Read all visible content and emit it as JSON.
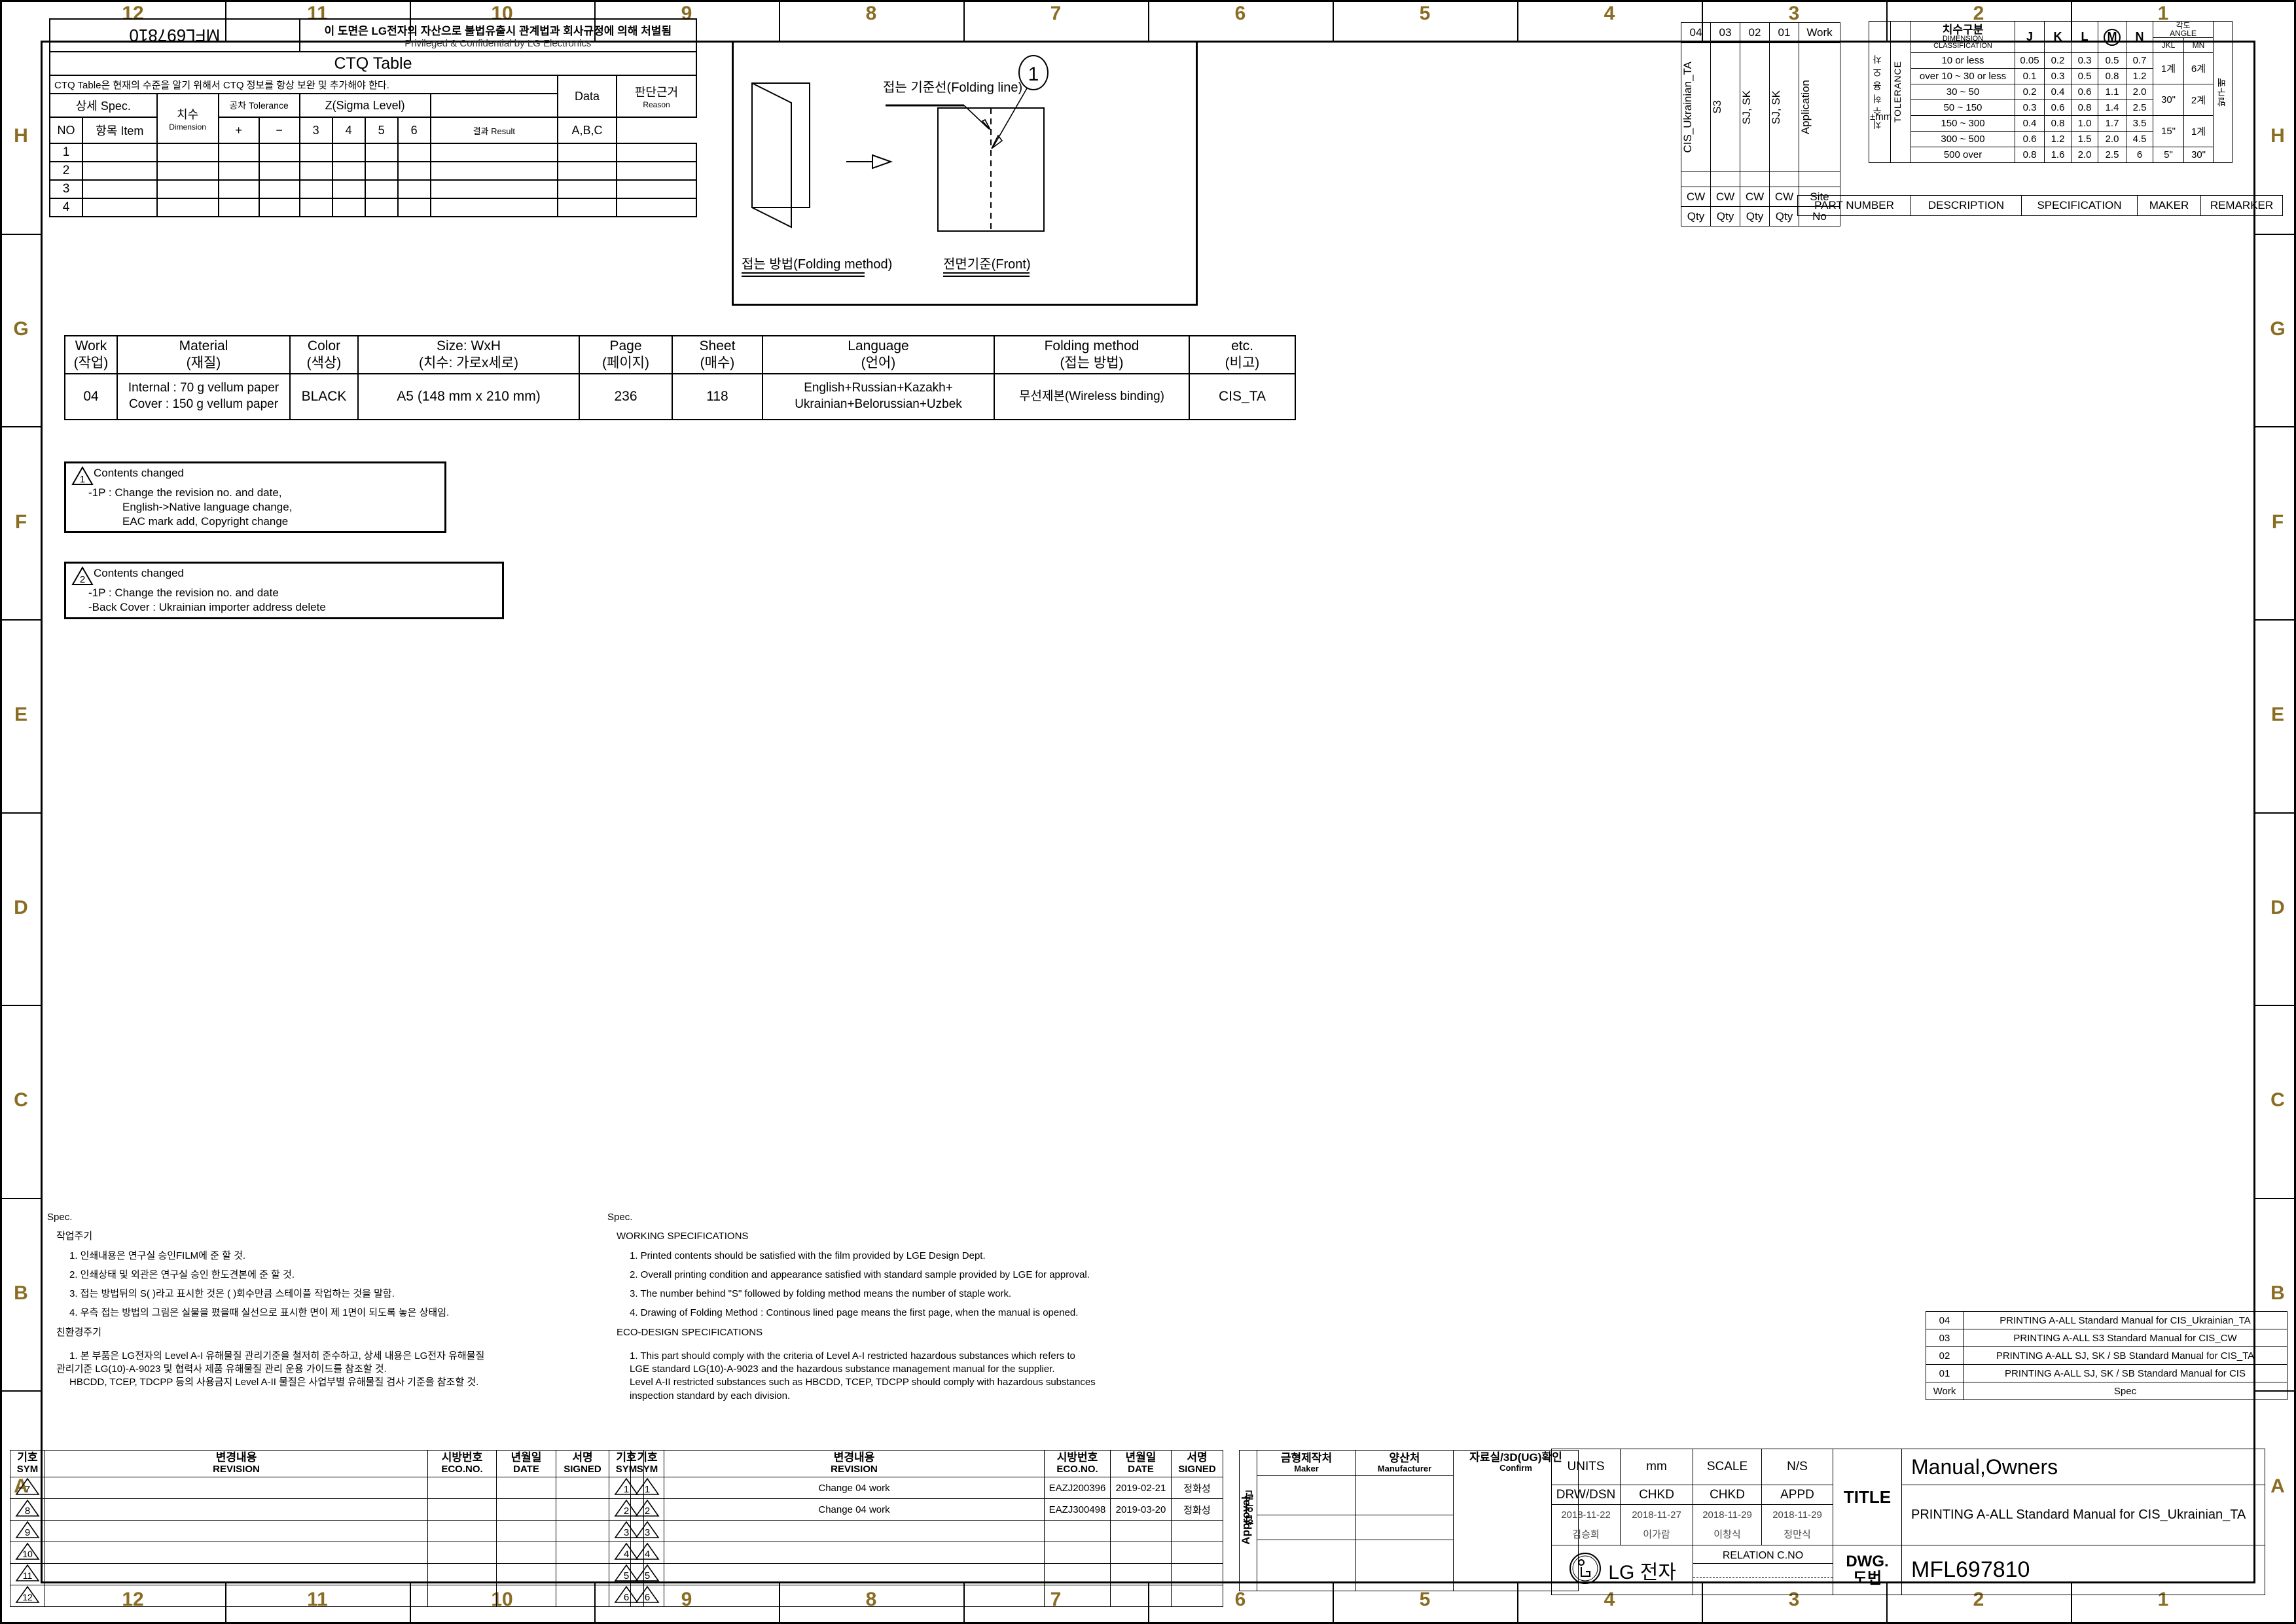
{
  "frame": {
    "grid_columns": [
      "12",
      "11",
      "10",
      "9",
      "8",
      "7",
      "6",
      "5",
      "4",
      "3",
      "2",
      "1"
    ],
    "grid_rows": [
      "H",
      "G",
      "F",
      "E",
      "D",
      "C",
      "B",
      "A"
    ]
  },
  "header": {
    "drawing_no_stamp": "MFL697810",
    "confidential_kr": "이 도면은 LG전자의 자산으로 불법유출시 관계법과 회사규정에 의해 처벌됨",
    "confidential_en": "Privileged & Confidential by LG Electronics"
  },
  "ctq": {
    "title": "CTQ Table",
    "note": "CTQ Table은 현재의 수준을 알기 위해서 CTQ 정보를 항상 보완 및 추가해야 한다.",
    "group_spec": "상세 Spec.",
    "group_dim": "치수",
    "group_tol": "공차 Tolerance",
    "group_sigma": "Z(Sigma Level)",
    "group_data": "Data",
    "group_reason_kr": "판단근거",
    "group_reason_en": "Reason",
    "col_no": "NO",
    "col_item": "항목 Item",
    "col_dimension": "Dimension",
    "col_plus": "+",
    "col_minus": "−",
    "sigma_levels": [
      "3",
      "4",
      "5",
      "6"
    ],
    "col_result": "결과 Result",
    "col_abc": "A,B,C",
    "rows": [
      "1",
      "2",
      "3",
      "4"
    ]
  },
  "folding_diagram": {
    "label_folding_line": "접는 기준선(Folding line)",
    "label_folding_method": "접는 방법(Folding method)",
    "label_front": "전면기준(Front)",
    "balloon": "1"
  },
  "main_spec": {
    "headers": [
      {
        "en": "Work",
        "kr": "(작업)"
      },
      {
        "en": "Material",
        "kr": "(재질)"
      },
      {
        "en": "Color",
        "kr": "(색상)"
      },
      {
        "en": "Size: WxH",
        "kr": "(치수: 가로x세로)"
      },
      {
        "en": "Page",
        "kr": "(페이지)"
      },
      {
        "en": "Sheet",
        "kr": "(매수)"
      },
      {
        "en": "Language",
        "kr": "(언어)"
      },
      {
        "en": "Folding method",
        "kr": "(접는 방법)"
      },
      {
        "en": "etc.",
        "kr": "(비고)"
      }
    ],
    "values": {
      "work": "04",
      "material_line1": "Internal : 70 g vellum paper",
      "material_line2": "Cover : 150 g vellum paper",
      "color": "BLACK",
      "size": "A5 (148 mm x 210 mm)",
      "page": "236",
      "sheet": "118",
      "language_line1": "English+Russian+Kazakh+",
      "language_line2": "Ukrainian+Belorussian+Uzbek",
      "folding_method": "무선제본(Wireless binding)",
      "etc": "CIS_TA"
    }
  },
  "change_notes": [
    {
      "symbol": "1",
      "title": "Contents changed",
      "lines": [
        "-1P : Change the revision no. and date,",
        "English->Native language change,",
        "EAC mark add, Copyright change"
      ]
    },
    {
      "symbol": "2",
      "title": "Contents changed",
      "lines": [
        "-1P : Change the revision no. and date",
        "-Back Cover : Ukrainian importer address delete"
      ]
    }
  ],
  "work_application": {
    "work_label": "Work",
    "application_label": "Application",
    "site_label": "Site",
    "no_label": "No",
    "columns": [
      {
        "work": "04",
        "application": "CIS_Ukrainian_TA",
        "site": "CW",
        "qty": "Qty"
      },
      {
        "work": "03",
        "application": "S3",
        "site": "CW",
        "qty": "Qty"
      },
      {
        "work": "02",
        "application": "SJ, SK",
        "site": "CW",
        "qty": "Qty"
      },
      {
        "work": "01",
        "application": "SJ, SK",
        "site": "CW",
        "qty": "Qty"
      }
    ],
    "part_headers": [
      "PART NUMBER",
      "DESCRIPTION",
      "SPECIFICATION",
      "MAKER",
      "REMARKER"
    ]
  },
  "tolerance": {
    "side_label_kr": "치 수 허 용 오 차",
    "side_label_en": "TOLERANCE",
    "unit": "±mm",
    "dim_class_kr": "치수구분",
    "dim_class_en1": "DIMENSION",
    "dim_class_en2": "CLASSIFICATION",
    "grade_cols": [
      "J",
      "K",
      "L",
      "M",
      "N"
    ],
    "angle_kr": "각도",
    "angle_en": "ANGLE",
    "angle_cols": [
      "JKL",
      "MN"
    ],
    "last_col_kr": "발구배",
    "rows": [
      {
        "range": "10 or less",
        "J": "0.05",
        "K": "0.2",
        "L": "0.3",
        "M": "0.5",
        "N": "0.7"
      },
      {
        "range": "over 10 ~ 30 or less",
        "J": "0.1",
        "K": "0.3",
        "L": "0.5",
        "M": "0.8",
        "N": "1.2"
      },
      {
        "range": "30 ~ 50",
        "J": "0.2",
        "K": "0.4",
        "L": "0.6",
        "M": "1.1",
        "N": "2.0"
      },
      {
        "range": "50 ~ 150",
        "J": "0.3",
        "K": "0.6",
        "L": "0.8",
        "M": "1.4",
        "N": "2.5"
      },
      {
        "range": "150 ~ 300",
        "J": "0.4",
        "K": "0.8",
        "L": "1.0",
        "M": "1.7",
        "N": "3.5"
      },
      {
        "range": "300 ~ 500",
        "J": "0.6",
        "K": "1.2",
        "L": "1.5",
        "M": "2.0",
        "N": "4.5"
      },
      {
        "range": "500 over",
        "J": "0.8",
        "K": "1.6",
        "L": "2.0",
        "M": "2.5",
        "N": "6"
      }
    ],
    "angle_groups": [
      {
        "jkl": "1계",
        "mn": "6계"
      },
      {
        "jkl": "30\"",
        "mn": "2계"
      },
      {
        "jkl": "15\"",
        "mn": "1계"
      },
      {
        "jkl": "5\"",
        "mn": "30\""
      }
    ]
  },
  "spec_kr": {
    "heading": "Spec.",
    "section1": "작업주기",
    "items1": [
      "1. 인쇄내용은 연구실 승인FILM에 준 할 것.",
      "2. 인쇄상태 및 외관은 연구실 승인 한도견본에 준 할 것.",
      "3. 접는 방법뒤의 S( )라고 표시한 것은 ( )회수만큼 스테이플 작업하는 것을 말함.",
      "4. 우측 접는 방법의 그림은 실물을 폈을때 실선으로 표시한 면이 제 1면이 되도록   놓은 상태임."
    ],
    "section2": "친환경주기",
    "items2": [
      "1. 본 부품은 LG전자의 Level A-I 유해물질 관리기준을 철저히 준수하고, 상세 내용은 LG전자 유해물질",
      "관리기준 LG(10)-A-9023 및 협력사 제품 유해물질 관리 운용 가이드를 참조할 것.",
      "HBCDD, TCEP, TDCPP 등의 사용금지 Level A-II 물질은 사업부별 유해물질 검사 기준을 참조할 것."
    ]
  },
  "spec_en": {
    "heading": "Spec.",
    "section1": "WORKING SPECIFICATIONS",
    "items1": [
      "1. Printed contents should be satisfied with the film provided by LGE Design Dept.",
      "2. Overall printing condition and appearance satisfied with standard sample provided by LGE for approval.",
      "3. The number behind \"S\" followed by folding method means the number of   staple work.",
      "4. Drawing of Folding Method : Continous lined page means the first page, when   the manual is opened."
    ],
    "section2": "ECO-DESIGN SPECIFICATIONS",
    "items2": [
      "1.  This part should comply with the criteria of Level A-I restricted hazardous substances which refers to",
      "LGE standard LG(10)-A-9023 and the hazardous substance management manual for the supplier.",
      "Level A-II restricted substances such as HBCDD, TCEP, TDCPP should comply with hazardous substances",
      "inspection standard by each division."
    ]
  },
  "revision_left": {
    "col_sym_kr": "기호",
    "col_sym_en": "SYM",
    "col_rev_kr": "변경내용",
    "col_rev_en": "REVISION",
    "col_eco_kr": "시방번호",
    "col_eco_en": "ECO.NO.",
    "col_date_kr": "년월일",
    "col_date_en": "DATE",
    "col_signed_kr": "서명",
    "col_signed_en": "SIGNED",
    "col_sym2_kr": "기호",
    "col_sym2_en": "SYM",
    "rows": [
      {
        "sym": "7",
        "revision": "",
        "eco": "",
        "date": "",
        "signed": "",
        "sym2": "1"
      },
      {
        "sym": "8",
        "revision": "",
        "eco": "",
        "date": "",
        "signed": "",
        "sym2": "2"
      },
      {
        "sym": "9",
        "revision": "",
        "eco": "",
        "date": "",
        "signed": "",
        "sym2": "3"
      },
      {
        "sym": "10",
        "revision": "",
        "eco": "",
        "date": "",
        "signed": "",
        "sym2": "4"
      },
      {
        "sym": "11",
        "revision": "",
        "eco": "",
        "date": "",
        "signed": "",
        "sym2": "5"
      },
      {
        "sym": "12",
        "revision": "",
        "eco": "",
        "date": "",
        "signed": "",
        "sym2": "6"
      }
    ]
  },
  "revision_right": {
    "rows": [
      {
        "sym": "1",
        "revision": "Change 04 work",
        "eco": "EAZJ200396",
        "date": "2019-02-21",
        "signed": "정화성"
      },
      {
        "sym": "2",
        "revision": "Change 04 work",
        "eco": "EAZJ300498",
        "date": "2019-03-20",
        "signed": "정화성"
      },
      {
        "sym": "3",
        "revision": "",
        "eco": "",
        "date": "",
        "signed": ""
      },
      {
        "sym": "4",
        "revision": "",
        "eco": "",
        "date": "",
        "signed": ""
      },
      {
        "sym": "5",
        "revision": "",
        "eco": "",
        "date": "",
        "signed": ""
      },
      {
        "sym": "6",
        "revision": "",
        "eco": "",
        "date": "",
        "signed": ""
      }
    ]
  },
  "approval": {
    "vertical_label_kr": "합 의 란",
    "vertical_label_en": "Approval",
    "maker_kr": "금형제작처",
    "maker_en": "Maker",
    "manufacturer_kr": "양산처",
    "manufacturer_en": "Manufacturer",
    "confirm_kr": "자료실/3D(UG)확인",
    "confirm_en": "Confirm"
  },
  "title_block": {
    "units_label": "UNITS",
    "units_value": "mm",
    "scale_label": "SCALE",
    "scale_value": "N/S",
    "roles": [
      "DRW/DSN",
      "CHKD",
      "CHKD",
      "APPD"
    ],
    "dates": [
      "2018-11-22",
      "2018-11-27",
      "2018-11-29",
      "2018-11-29"
    ],
    "names": [
      "김승희",
      "이가람",
      "이창식",
      "정만식"
    ],
    "company": "LG 전자",
    "relation_label": "RELATION C.NO",
    "title_label": "TITLE",
    "title_value": "Manual,Owners",
    "title_sub": "PRINTING A-ALL Standard Manual for CIS_Ukrainian_TA",
    "dwg_label_en": "DWG.",
    "dwg_label_kr": "도번",
    "dwg_value": "MFL697810"
  },
  "work_spec_list": {
    "col_work": "Work",
    "col_spec": "Spec",
    "rows": [
      {
        "work": "04",
        "spec": "PRINTING A-ALL Standard Manual for CIS_Ukrainian_TA"
      },
      {
        "work": "03",
        "spec": "PRINTING A-ALL S3 Standard Manual for CIS_CW"
      },
      {
        "work": "02",
        "spec": "PRINTING A-ALL SJ, SK / SB Standard Manual for CIS_TA"
      },
      {
        "work": "01",
        "spec": "PRINTING A-ALL SJ, SK / SB Standard Manual for CIS"
      }
    ]
  }
}
